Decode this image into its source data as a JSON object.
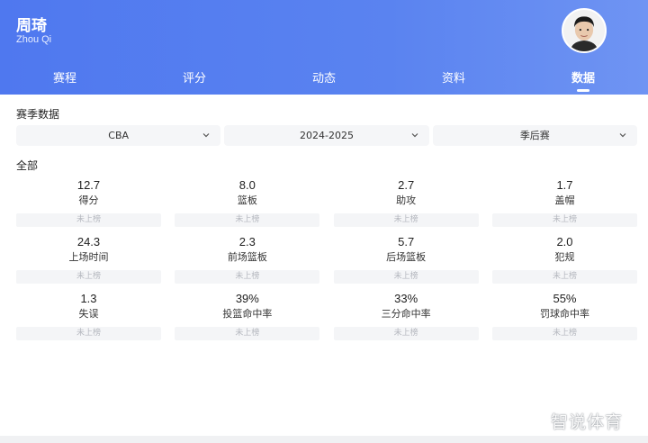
{
  "header": {
    "player_name": "周琦",
    "player_name_en": "Zhou Qi"
  },
  "tabs": [
    {
      "label": "赛程",
      "active": false
    },
    {
      "label": "评分",
      "active": false
    },
    {
      "label": "动态",
      "active": false
    },
    {
      "label": "资料",
      "active": false
    },
    {
      "label": "数据",
      "active": true
    }
  ],
  "season_section": {
    "title": "赛季数据",
    "filters": [
      {
        "value": "CBA"
      },
      {
        "value": "2024-2025"
      },
      {
        "value": "季后赛"
      }
    ]
  },
  "stats_section": {
    "title": "全部",
    "rows": [
      [
        {
          "value": "12.7",
          "label": "得分",
          "rank": "未上榜"
        },
        {
          "value": "8.0",
          "label": "篮板",
          "rank": "未上榜"
        },
        {
          "value": "2.7",
          "label": "助攻",
          "rank": "未上榜"
        },
        {
          "value": "1.7",
          "label": "盖帽",
          "rank": "未上榜"
        }
      ],
      [
        {
          "value": "24.3",
          "label": "上场时间",
          "rank": "未上榜"
        },
        {
          "value": "2.3",
          "label": "前场篮板",
          "rank": "未上榜"
        },
        {
          "value": "5.7",
          "label": "后场篮板",
          "rank": "未上榜"
        },
        {
          "value": "2.0",
          "label": "犯规",
          "rank": "未上榜"
        }
      ],
      [
        {
          "value": "1.3",
          "label": "失误",
          "rank": "未上榜"
        },
        {
          "value": "39%",
          "label": "投篮命中率",
          "rank": "未上榜"
        },
        {
          "value": "33%",
          "label": "三分命中率",
          "rank": "未上榜"
        },
        {
          "value": "55%",
          "label": "罚球命中率",
          "rank": "未上榜"
        }
      ]
    ]
  },
  "watermark": "智说体育",
  "icons": {
    "avatar": "player-avatar",
    "dropdown": "chevron-down-icon"
  },
  "colors": {
    "header_blue": "#5a83f0",
    "rank_bg": "#f4f5f7",
    "rank_text": "#b5b8bf"
  }
}
